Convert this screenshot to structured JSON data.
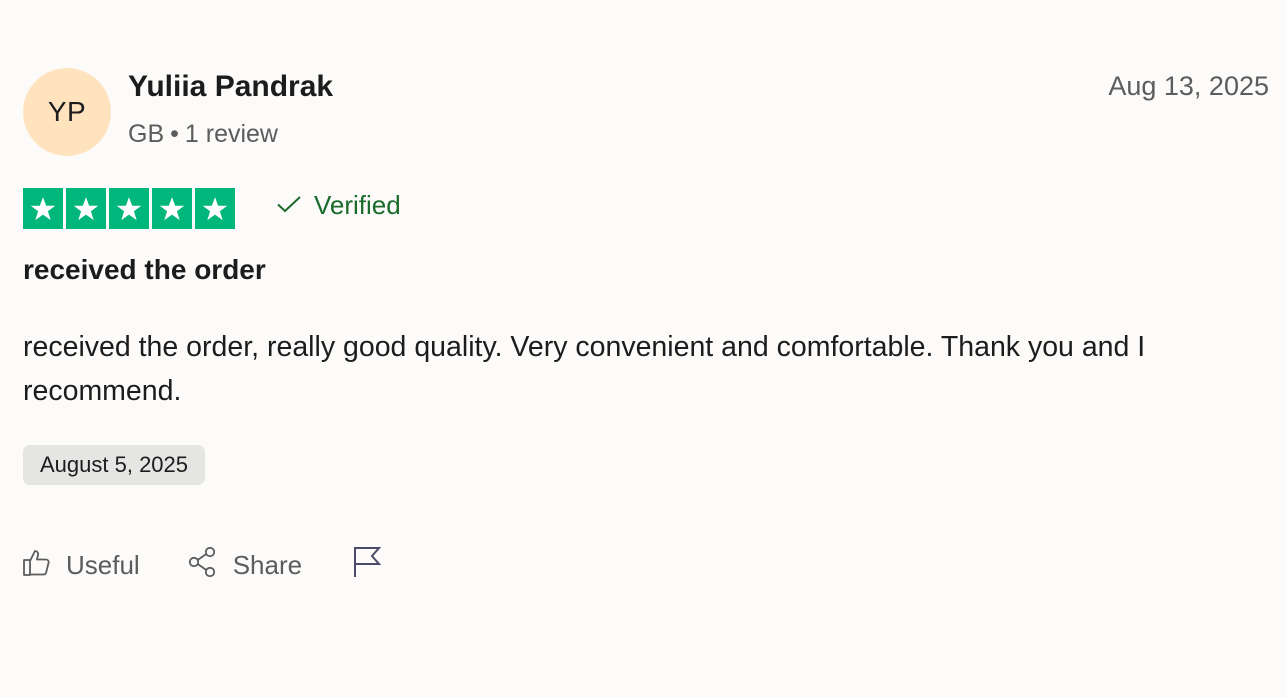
{
  "review": {
    "avatar_initials": "YP",
    "avatar_color": "#ffe3bf",
    "reviewer_name": "Yuliia Pandrak",
    "country": "GB",
    "separator": "•",
    "review_count": "1 review",
    "posted_date": "Aug 13, 2025",
    "rating": 5,
    "rating_max": 5,
    "star_color": "#00b67a",
    "verified_label": "Verified",
    "verified_color": "#1b6b2c",
    "title": "received the order",
    "text": "received the order, really good quality. Very convenient and comfortable. Thank you and I recommend.",
    "experience_date": "August 5, 2025"
  },
  "actions": {
    "useful_label": "Useful",
    "useful_icon": "thumbs-up-icon",
    "share_label": "Share",
    "share_icon": "share-icon",
    "report_icon": "flag-icon"
  }
}
